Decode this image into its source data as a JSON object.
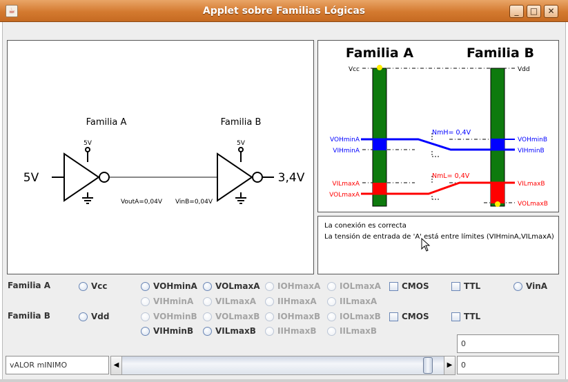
{
  "window": {
    "title": "Applet sobre Familias Lógicas",
    "app_icon": "java-cup-icon",
    "buttons": {
      "minimize": "_",
      "maximize": "□",
      "close": "✕"
    }
  },
  "circuit": {
    "family_a": "Familia A",
    "family_b": "Familia B",
    "vcc_a": "5V",
    "vcc_b": "5V",
    "input_voltage": "5V",
    "output_voltage": "3,4V",
    "vout_a": "VoutA=0,04V",
    "vin_b": "VinB=0,04V"
  },
  "levels": {
    "family_a": "Familia A",
    "family_b": "Familia B",
    "vcc": "Vcc",
    "vdd": "Vdd",
    "vohmin_a": "VOHminA",
    "vihmin_a": "VIHminA",
    "vilmax_a": "VILmaxA",
    "volmax_a": "VOLmaxA",
    "vohmin_b": "VOHminB",
    "vihmin_b": "VIHminB",
    "vilmax_b": "VILmaxB",
    "volmax_b": "VOLmaxB",
    "nmh": "NmH= 0,4V",
    "nml": "NmL= 0,4V",
    "colors": {
      "bar": "#0e7a0e",
      "high_level": "#0000ff",
      "low_level": "#ff0000",
      "marker": "#ffee00"
    }
  },
  "status": {
    "line1": "La conexión es correcta",
    "line2": "La tensión de entrada de 'A' está entre límites (VIHminA,VILmaxA)"
  },
  "controls": {
    "family_a_label": "Familia A",
    "family_b_label": "Familia B",
    "a_vcc": "Vcc",
    "a_vohmin": "VOHminA",
    "a_volmax": "VOLmaxA",
    "a_iohmax": "IOHmaxA",
    "a_iolmax": "IOLmaxA",
    "a_cmos": "CMOS",
    "a_ttl": "TTL",
    "a_vin": "VinA",
    "a_vihmin": "VIHminA",
    "a_vilmax": "VILmaxA",
    "a_iihmax": "IIHmaxA",
    "a_iilmax": "IILmaxA",
    "b_vdd": "Vdd",
    "b_vohmin": "VOHminB",
    "b_volmax": "VOLmaxB",
    "b_iohmax": "IOHmaxB",
    "b_iolmax": "IOLmaxB",
    "b_cmos": "CMOS",
    "b_ttl": "TTL",
    "b_vihmin": "VIHminB",
    "b_vilmax": "VILmaxB",
    "b_iihmax": "IIHmaxB",
    "b_iilmax": "IILmaxB"
  },
  "bottom": {
    "value_label": "vALOR mINIMO",
    "value_top": "0",
    "value_bottom": "0",
    "scroll_left": "◀",
    "scroll_right": "▶"
  }
}
